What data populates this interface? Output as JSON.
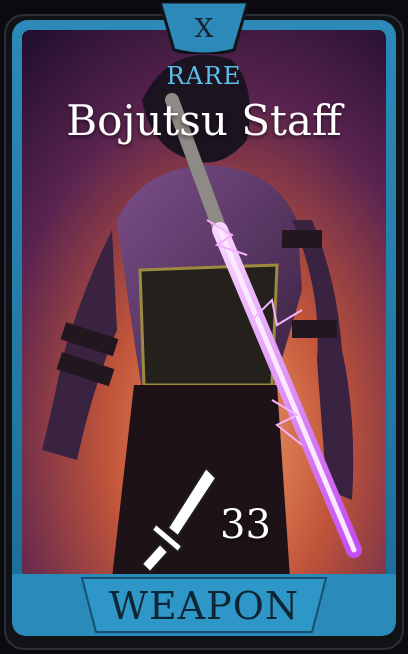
{
  "card": {
    "close_label": "X",
    "rarity": "RARE",
    "title": "Bojutsu Staff",
    "power": "33",
    "type": "WEAPON"
  },
  "icons": {
    "stat": "sword-icon"
  },
  "colors": {
    "frame_blue": "#2c89b8",
    "rarity_text": "#5bc0ea",
    "banner_text": "#0e2633",
    "staff_glow": "#e06cff"
  }
}
